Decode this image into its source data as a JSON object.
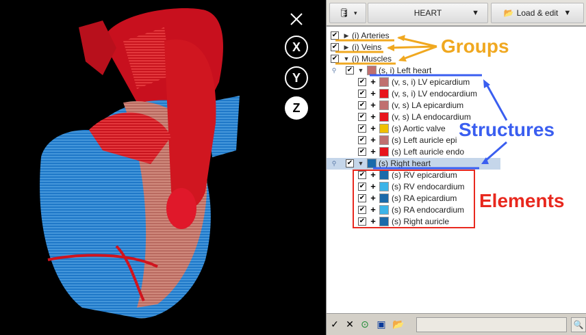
{
  "viewer": {
    "axis_buttons": [
      "X",
      "Y",
      "Z"
    ],
    "active_axis": "Z",
    "close_icon": "close-icon"
  },
  "toolbar": {
    "structure_name": "HEART",
    "load_edit_label": "Load & edit",
    "db_icon": "database-icon",
    "folder_icon": "folder-open-icon"
  },
  "tree": {
    "groups": [
      {
        "label": "(i) Arteries",
        "expanded": false
      },
      {
        "label": "(i) Veins",
        "expanded": false
      },
      {
        "label": "(i) Muscles",
        "expanded": true
      }
    ],
    "structures": [
      {
        "label": "(s, i) Left heart",
        "color": "#c07070",
        "selected": false,
        "elements": [
          {
            "label": "(v, s, i) LV epicardium",
            "color": "#c07070"
          },
          {
            "label": "(v, s, i) LV endocardium",
            "color": "#e8141c"
          },
          {
            "label": "(v, s) LA epicardium",
            "color": "#c07070"
          },
          {
            "label": "(v, s) LA endocardium",
            "color": "#e8141c"
          },
          {
            "label": "(s) Aortic valve",
            "color": "#f0c000"
          },
          {
            "label": "(s) Left auricle epi",
            "color": "#c07070"
          },
          {
            "label": "(s) Left auricle endo",
            "color": "#e8141c"
          }
        ]
      },
      {
        "label": "(s) Right heart",
        "color": "#1a6aaa",
        "selected": true,
        "elements": [
          {
            "label": "(s) RV epicardium",
            "color": "#1a6aaa"
          },
          {
            "label": "(s) RV endocardium",
            "color": "#3cb4e8"
          },
          {
            "label": "(s) RA epicardium",
            "color": "#1a6aaa"
          },
          {
            "label": "(s) RA endocardium",
            "color": "#3cb4e8"
          },
          {
            "label": "(s) Right auricle",
            "color": "#1a6aaa"
          }
        ]
      }
    ]
  },
  "bottombar": {
    "icons": [
      "check-icon",
      "x-icon",
      "down-circle-icon",
      "save-icon",
      "folder-open-icon",
      "zoom-icon"
    ]
  },
  "annotations": {
    "groups_label": "Groups",
    "structures_label": "Structures",
    "elements_label": "Elements",
    "colors": {
      "groups": "#f0a820",
      "structures": "#3a5ef0",
      "elements": "#e8281e"
    }
  }
}
